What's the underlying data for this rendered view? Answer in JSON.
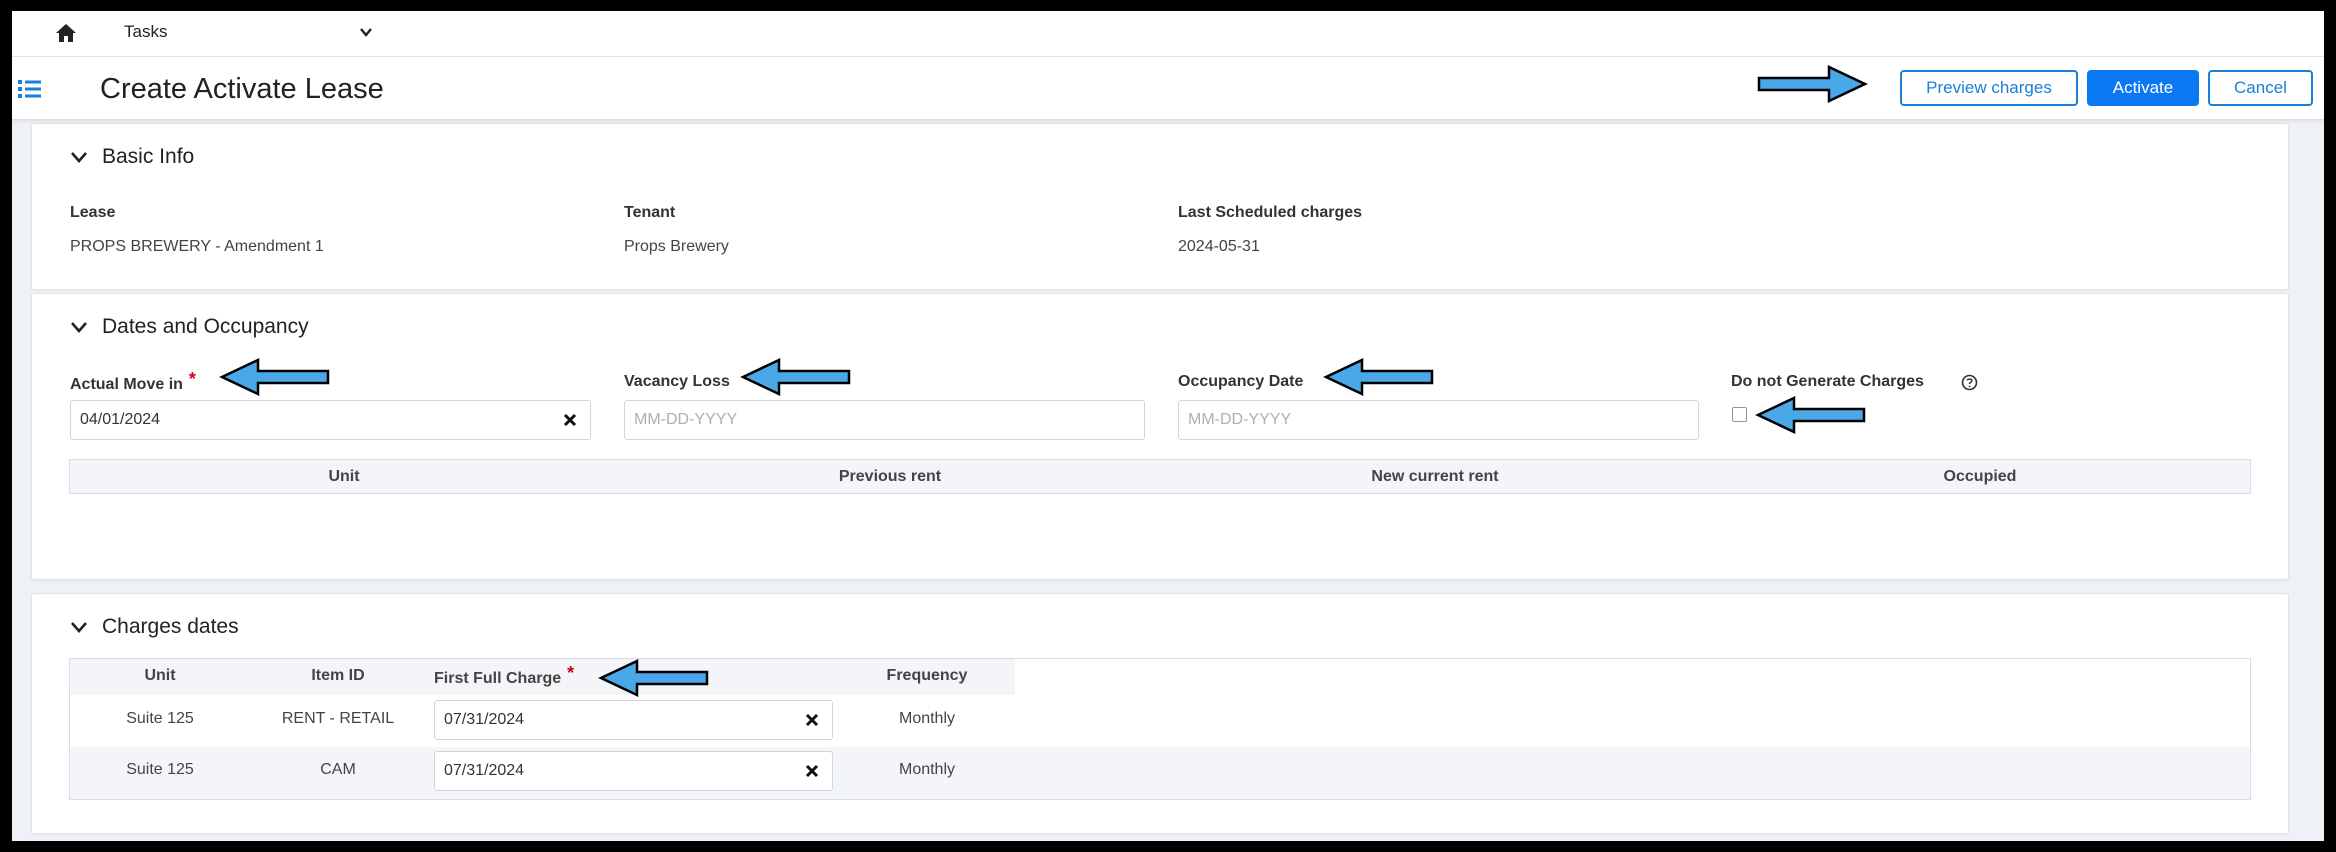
{
  "topnav": {
    "tasks_label": "Tasks"
  },
  "header": {
    "title": "Create Activate Lease",
    "preview_label": "Preview charges",
    "activate_label": "Activate",
    "cancel_label": "Cancel"
  },
  "basic_info": {
    "heading": "Basic Info",
    "fields": [
      {
        "label": "Lease",
        "value": "PROPS BREWERY - Amendment 1"
      },
      {
        "label": "Tenant",
        "value": "Props Brewery"
      },
      {
        "label": "Last Scheduled charges",
        "value": "2024-05-31"
      }
    ]
  },
  "dates_occupancy": {
    "heading": "Dates and Occupancy",
    "move_in_label": "Actual Move in",
    "move_in_value": "04/01/2024",
    "vacancy_label": "Vacancy Loss",
    "vacancy_placeholder": "MM-DD-YYYY",
    "occupancy_label": "Occupancy Date",
    "occupancy_placeholder": "MM-DD-YYYY",
    "no_charges_label": "Do not Generate Charges",
    "no_charges_checked": false,
    "table_headers": [
      "Unit",
      "Previous rent",
      "New current rent",
      "Occupied"
    ]
  },
  "charges_dates": {
    "heading": "Charges dates",
    "headers": [
      "Unit",
      "Item ID",
      "First Full Charge",
      "Frequency"
    ],
    "rows": [
      {
        "unit": "Suite 125",
        "item_id": "RENT - RETAIL",
        "first_full_charge": "07/31/2024",
        "frequency": "Monthly"
      },
      {
        "unit": "Suite 125",
        "item_id": "CAM",
        "first_full_charge": "07/31/2024",
        "frequency": "Monthly"
      }
    ]
  },
  "required_marker": "*",
  "colors": {
    "accent": "#0a78f0",
    "outline_button": "#1a7fd6",
    "required": "#d0021b",
    "annotation_arrow": "#4aa8e8"
  },
  "icons": {
    "home": "home-icon",
    "tasks_dropdown": "chevron-down-icon",
    "menu": "list-icon",
    "collapse": "chevron-down-icon",
    "clear": "close-icon",
    "help": "question-circle-icon",
    "annotation": "arrow-icon"
  }
}
